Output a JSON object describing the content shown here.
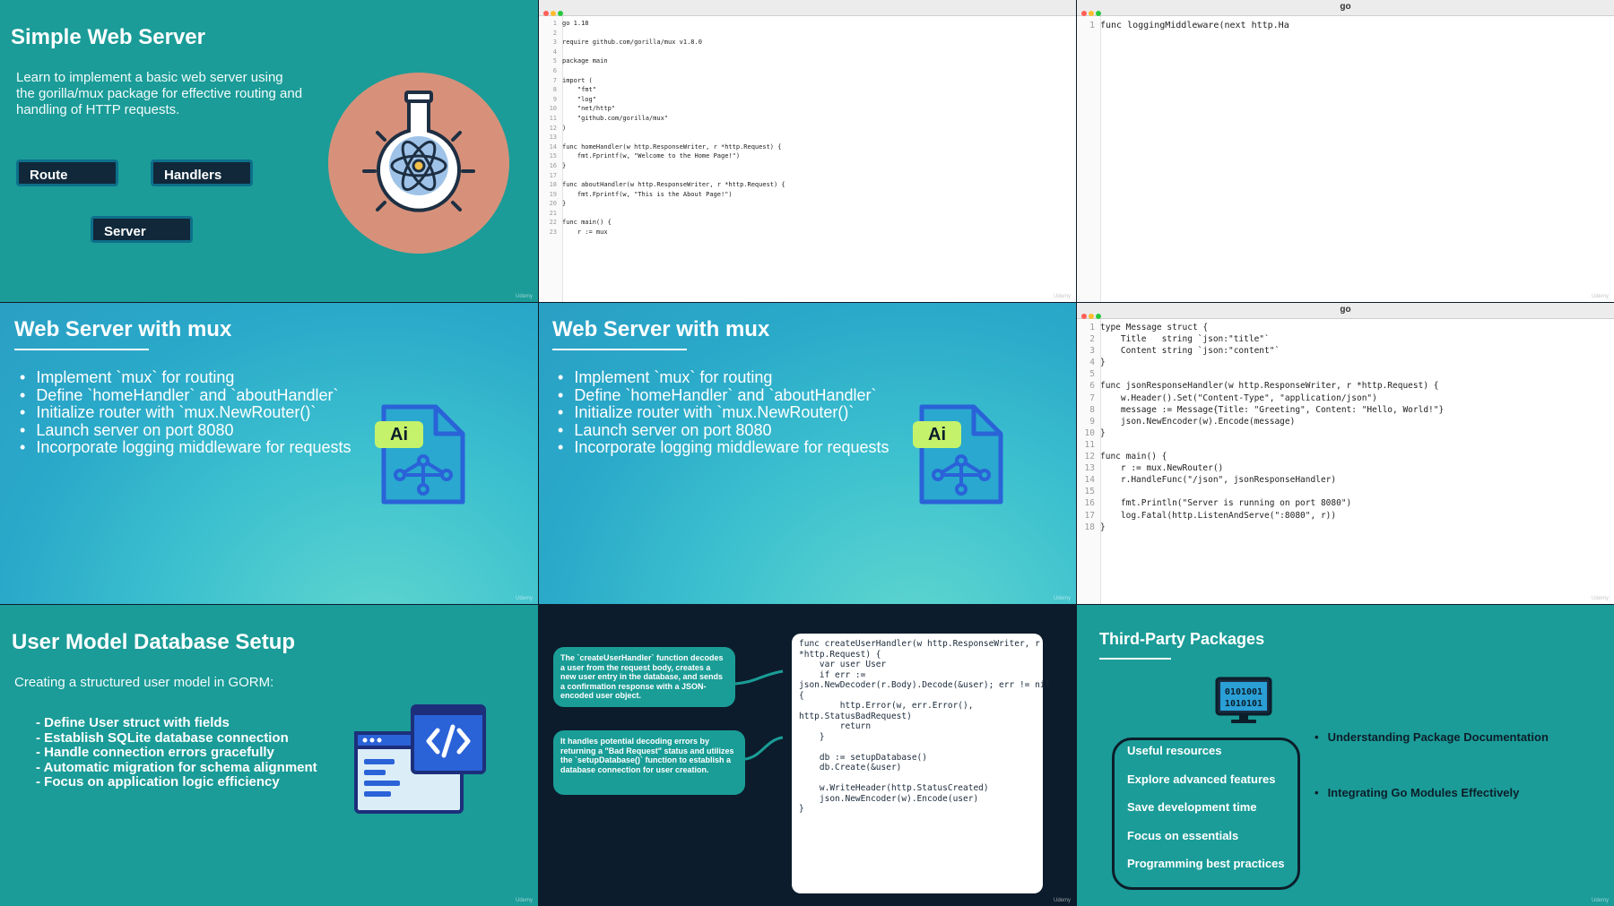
{
  "watermark": "Udemy",
  "slide1": {
    "title": "Simple Web Server",
    "description": "Learn to implement a basic web server using the gorilla/mux package for effective routing and handling of HTTP requests.",
    "buttons": [
      "Route",
      "Handlers",
      "Server"
    ],
    "icon": "flask-atom-icon"
  },
  "editor1": {
    "title": "",
    "lines": [
      {
        "n": "1",
        "t": "go 1.18"
      },
      {
        "n": "2",
        "t": ""
      },
      {
        "n": "3",
        "t": "require github.com/gorilla/mux v1.8.0"
      },
      {
        "n": "4",
        "t": ""
      },
      {
        "n": "5",
        "t": "package main"
      },
      {
        "n": "6",
        "t": ""
      },
      {
        "n": "7",
        "t": "import ("
      },
      {
        "n": "8",
        "t": "    \"fmt\""
      },
      {
        "n": "9",
        "t": "    \"log\""
      },
      {
        "n": "10",
        "t": "    \"net/http\""
      },
      {
        "n": "11",
        "t": "    \"github.com/gorilla/mux\""
      },
      {
        "n": "12",
        "t": ")"
      },
      {
        "n": "13",
        "t": ""
      },
      {
        "n": "14",
        "t": "func homeHandler(w http.ResponseWriter, r *http.Request) {"
      },
      {
        "n": "15",
        "t": "    fmt.Fprintf(w, \"Welcome to the Home Page!\")"
      },
      {
        "n": "16",
        "t": "}"
      },
      {
        "n": "17",
        "t": ""
      },
      {
        "n": "18",
        "t": "func aboutHandler(w http.ResponseWriter, r *http.Request) {"
      },
      {
        "n": "19",
        "t": "    fmt.Fprintf(w, \"This is the About Page!\")"
      },
      {
        "n": "20",
        "t": "}"
      },
      {
        "n": "21",
        "t": ""
      },
      {
        "n": "22",
        "t": "func main() {"
      },
      {
        "n": "23",
        "t": "    r := mux"
      }
    ]
  },
  "editor2": {
    "title": "go",
    "lines": [
      {
        "n": "1",
        "t": "func loggingMiddleware(next http.Ha"
      }
    ]
  },
  "slide3": {
    "title": "Web Server with mux",
    "bullets": [
      "Implement `mux` for routing",
      "Define `homeHandler` and `aboutHandler`",
      "Initialize router with `mux.NewRouter()`",
      "Launch server on port 8080",
      "Incorporate logging middleware for requests"
    ],
    "badge": "Ai",
    "icon": "ai-file-icon"
  },
  "slide4": {
    "title": "Web Server with mux",
    "bullets": [
      "Implement `mux` for routing",
      "Define `homeHandler` and `aboutHandler`",
      "Initialize router with `mux.NewRouter()`",
      "Launch server on port 8080",
      "Incorporate logging middleware for requests"
    ],
    "badge": "Ai",
    "icon": "ai-file-icon"
  },
  "editor3": {
    "title": "go",
    "lines": [
      {
        "n": "1",
        "t": "type Message struct {"
      },
      {
        "n": "2",
        "t": "    Title   string `json:\"title\"`"
      },
      {
        "n": "3",
        "t": "    Content string `json:\"content\"`"
      },
      {
        "n": "4",
        "t": "}"
      },
      {
        "n": "5",
        "t": ""
      },
      {
        "n": "6",
        "t": "func jsonResponseHandler(w http.ResponseWriter, r *http.Request) {"
      },
      {
        "n": "7",
        "t": "    w.Header().Set(\"Content-Type\", \"application/json\")"
      },
      {
        "n": "8",
        "t": "    message := Message{Title: \"Greeting\", Content: \"Hello, World!\"}"
      },
      {
        "n": "9",
        "t": "    json.NewEncoder(w).Encode(message)"
      },
      {
        "n": "10",
        "t": "}"
      },
      {
        "n": "11",
        "t": ""
      },
      {
        "n": "12",
        "t": "func main() {"
      },
      {
        "n": "13",
        "t": "    r := mux.NewRouter()"
      },
      {
        "n": "14",
        "t": "    r.HandleFunc(\"/json\", jsonResponseHandler)"
      },
      {
        "n": "15",
        "t": ""
      },
      {
        "n": "16",
        "t": "    fmt.Println(\"Server is running on port 8080\")"
      },
      {
        "n": "17",
        "t": "    log.Fatal(http.ListenAndServe(\":8080\", r))"
      },
      {
        "n": "18",
        "t": "}"
      }
    ]
  },
  "slide7": {
    "title": "User Model Database Setup",
    "subtitle": "Creating a structured user model in GORM:",
    "items": [
      "- Define User struct with fields",
      "- Establish SQLite database connection",
      "- Handle connection errors gracefully",
      "- Automatic migration for schema alignment",
      "- Focus on application logic efficiency"
    ],
    "icon": "code-window-icon"
  },
  "slide8": {
    "bubble1": "The `createUserHandler` function decodes a user from the request body, creates a new user entry in the database, and sends a confirmation response with a JSON-encoded user object.",
    "bubble2": "It handles potential decoding errors by returning a \"Bad Request\" status and utilizes the `setupDatabase()` function to establish a database connection for user creation.",
    "code": [
      "func createUserHandler(w http.ResponseWriter, r",
      "*http.Request) {",
      "    var user User",
      "    if err :=",
      "json.NewDecoder(r.Body).Decode(&user); err != nil",
      "{",
      "        http.Error(w, err.Error(),",
      "http.StatusBadRequest)",
      "        return",
      "    }",
      "",
      "    db := setupDatabase()",
      "    db.Create(&user)",
      "",
      "    w.WriteHeader(http.StatusCreated)",
      "    json.NewEncoder(w).Encode(user)",
      "}"
    ]
  },
  "slide9": {
    "title": "Third-Party Packages",
    "resources": [
      "Useful resources",
      "Explore advanced features",
      "Save development time",
      "Focus on essentials",
      "Programming best practices"
    ],
    "side_items": [
      "Understanding Package Documentation",
      "Integrating Go Modules Effectively"
    ],
    "monitor_text_1": "0101001",
    "monitor_text_2": "1010101",
    "icon": "binary-monitor-icon"
  },
  "colors": {
    "teal": "#1b9c98",
    "dark_navy": "#0c1c2c",
    "badge_green": "#c5f26b",
    "accent_blue": "#2a62d8"
  }
}
